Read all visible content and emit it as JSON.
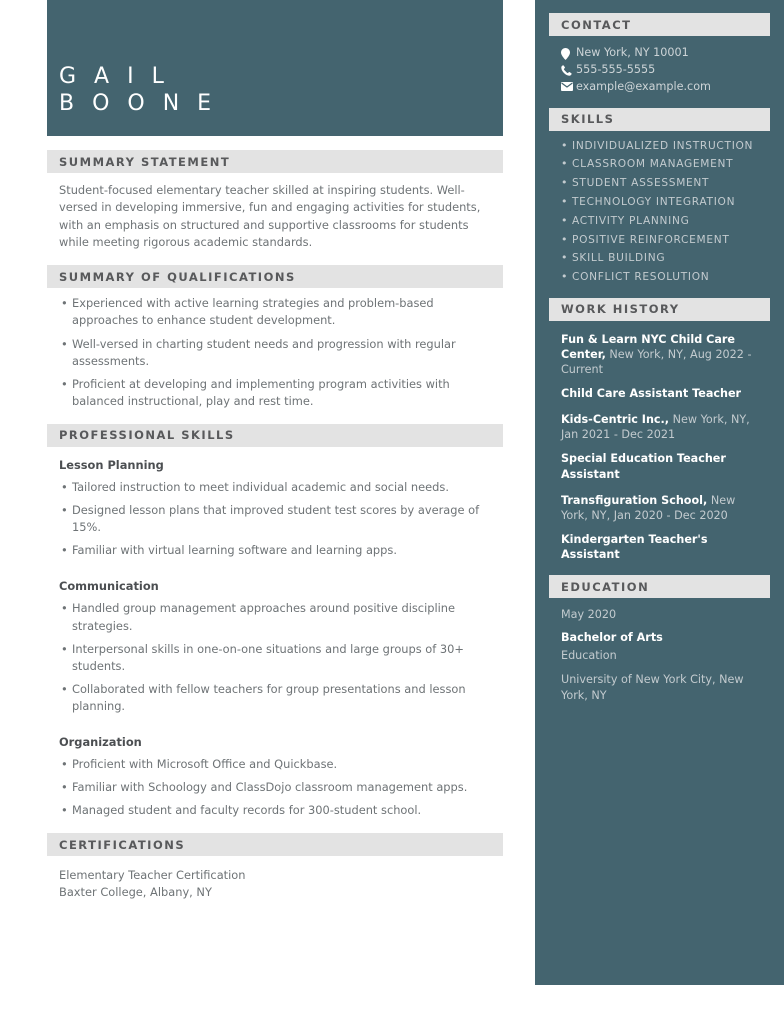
{
  "name": {
    "first": "G A I L",
    "last": "B O O N E"
  },
  "sections": {
    "summary_statement": {
      "heading": "SUMMARY STATEMENT",
      "text": "Student-focused elementary teacher skilled at inspiring students. Well-versed in developing immersive, fun and engaging activities for students, with an emphasis on structured and supportive classrooms for students while meeting rigorous academic standards."
    },
    "summary_of_qualifications": {
      "heading": "SUMMARY OF QUALIFICATIONS",
      "bullets": [
        "Experienced with active learning strategies and problem-based approaches to enhance student development.",
        "Well-versed in charting student needs and progression with regular assessments.",
        "Proficient at developing and implementing program activities with balanced instructional, play and rest time."
      ]
    },
    "professional_skills": {
      "heading": "PROFESSIONAL SKILLS",
      "groups": [
        {
          "title": "Lesson Planning",
          "bullets": [
            "Tailored instruction to meet individual academic and social needs.",
            "Designed lesson plans that improved student test scores by average of 15%.",
            "Familiar with virtual learning software and learning apps."
          ]
        },
        {
          "title": "Communication",
          "bullets": [
            "Handled group management approaches around positive discipline strategies.",
            "Interpersonal skills in one-on-one situations and large groups of 30+ students.",
            "Collaborated with fellow teachers for group presentations and lesson planning."
          ]
        },
        {
          "title": "Organization",
          "bullets": [
            "Proficient with Microsoft Office and Quickbase.",
            "Familiar with Schoology and ClassDojo classroom management apps.",
            "Managed student and faculty records for 300-student school."
          ]
        }
      ]
    },
    "certifications": {
      "heading": "CERTIFICATIONS",
      "lines": [
        "Elementary Teacher Certification",
        "Baxter College, Albany, NY"
      ]
    }
  },
  "sidebar": {
    "contact": {
      "heading": "CONTACT",
      "items": [
        {
          "icon": "location-pin-icon",
          "value": "New York, NY 10001"
        },
        {
          "icon": "phone-icon",
          "value": "555-555-5555"
        },
        {
          "icon": "envelope-icon",
          "value": "example@example.com"
        }
      ]
    },
    "skills": {
      "heading": "SKILLS",
      "items": [
        "INDIVIDUALIZED INSTRUCTION",
        "CLASSROOM MANAGEMENT",
        "STUDENT ASSESSMENT",
        "TECHNOLOGY INTEGRATION",
        "ACTIVITY PLANNING",
        "POSITIVE REINFORCEMENT",
        "SKILL BUILDING",
        "CONFLICT RESOLUTION"
      ]
    },
    "work_history": {
      "heading": "WORK HISTORY",
      "jobs": [
        {
          "employer": "Fun & Learn NYC Child Care Center,",
          "detail": " New York, NY, Aug 2022 - Current",
          "title": "Child Care Assistant Teacher"
        },
        {
          "employer": "Kids-Centric Inc.,",
          "detail": " New York, NY, Jan 2021 - Dec 2021",
          "title": "Special Education Teacher Assistant"
        },
        {
          "employer": "Transfiguration School,",
          "detail": " New York, NY, Jan 2020 - Dec 2020",
          "title": "Kindergarten Teacher's Assistant"
        }
      ]
    },
    "education": {
      "heading": "EDUCATION",
      "date": "May 2020",
      "degree": "Bachelor of Arts",
      "field": "Education",
      "institution": "University of New York City, New York, NY"
    }
  },
  "colors": {
    "accent_teal": "#44646f",
    "bar_gray": "#e3e3e3",
    "body_gray": "#6e7376"
  }
}
